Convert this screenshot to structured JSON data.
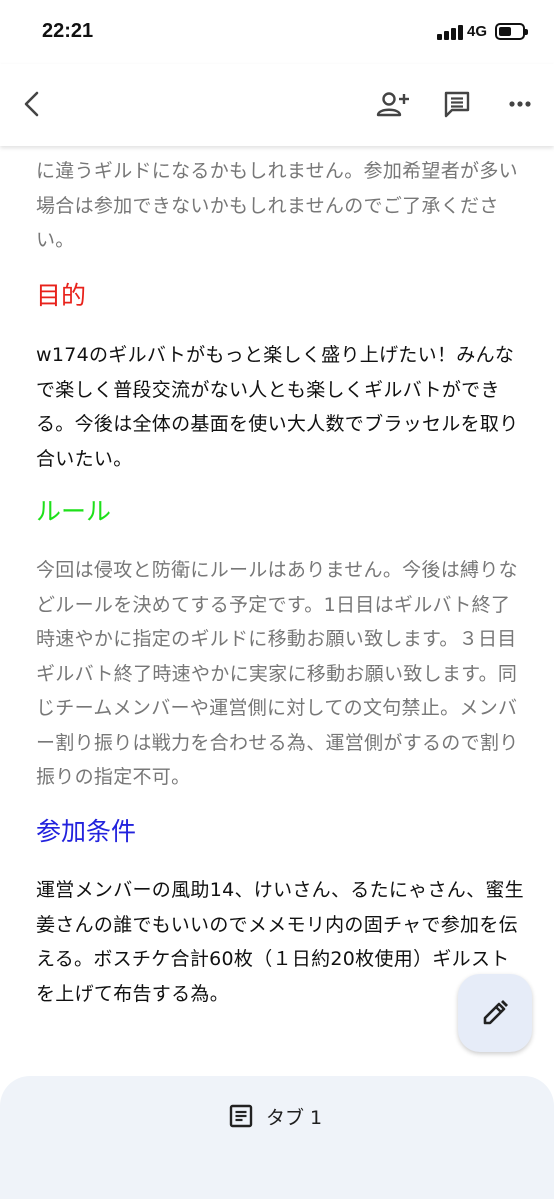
{
  "status": {
    "time": "22:21",
    "network": "4G"
  },
  "toolbar": {
    "icons": [
      "back-arrow-icon",
      "add-person-icon",
      "comment-icon",
      "more-horizontal-icon"
    ]
  },
  "doc": {
    "intro_text": "に違うギルドになるかもしれません。参加希望者が多い場合は参加できないかもしれませんのでご了承ください。",
    "sections": [
      {
        "heading": "目的",
        "heading_color": "#e8221b",
        "body": "w174のギルバトがもっと楽しく盛り上げたい！みんなで楽しく普段交流がない人とも楽しくギルバトができる。今後は全体の基面を使い大人数でブラッセルを取り合いたい。",
        "body_color": "#111111"
      },
      {
        "heading": "ルール",
        "heading_color": "#1ee01a",
        "body": "今回は侵攻と防衛にルールはありません。今後は縛りなどルールを決めてする予定です。1日目はギルバト終了時速やかに指定のギルドに移動お願い致します。３日目ギルバト終了時速やかに実家に移動お願い致します。同じチームメンバーや運営側に対しての文句禁止。メンバー割り振りは戦力を合わせる為、運営側がするので割り振りの指定不可。",
        "body_color": "#777777"
      },
      {
        "heading": "参加条件",
        "heading_color": "#2222dd",
        "body": "運営メンバーの風助14、けいさん、るたにゃさん、蜜生姜さんの誰でもいいのでメメモリ内の固チャで参加を伝える。ボスチケ合計60枚（１日約20枚使用）ギルストを上げて布告する為。",
        "body_color": "#111111"
      }
    ]
  },
  "fab": {
    "icon": "pencil-edit-icon"
  },
  "tabbar": {
    "tab_label": "タブ 1",
    "tab_icon": "document-list-icon"
  }
}
